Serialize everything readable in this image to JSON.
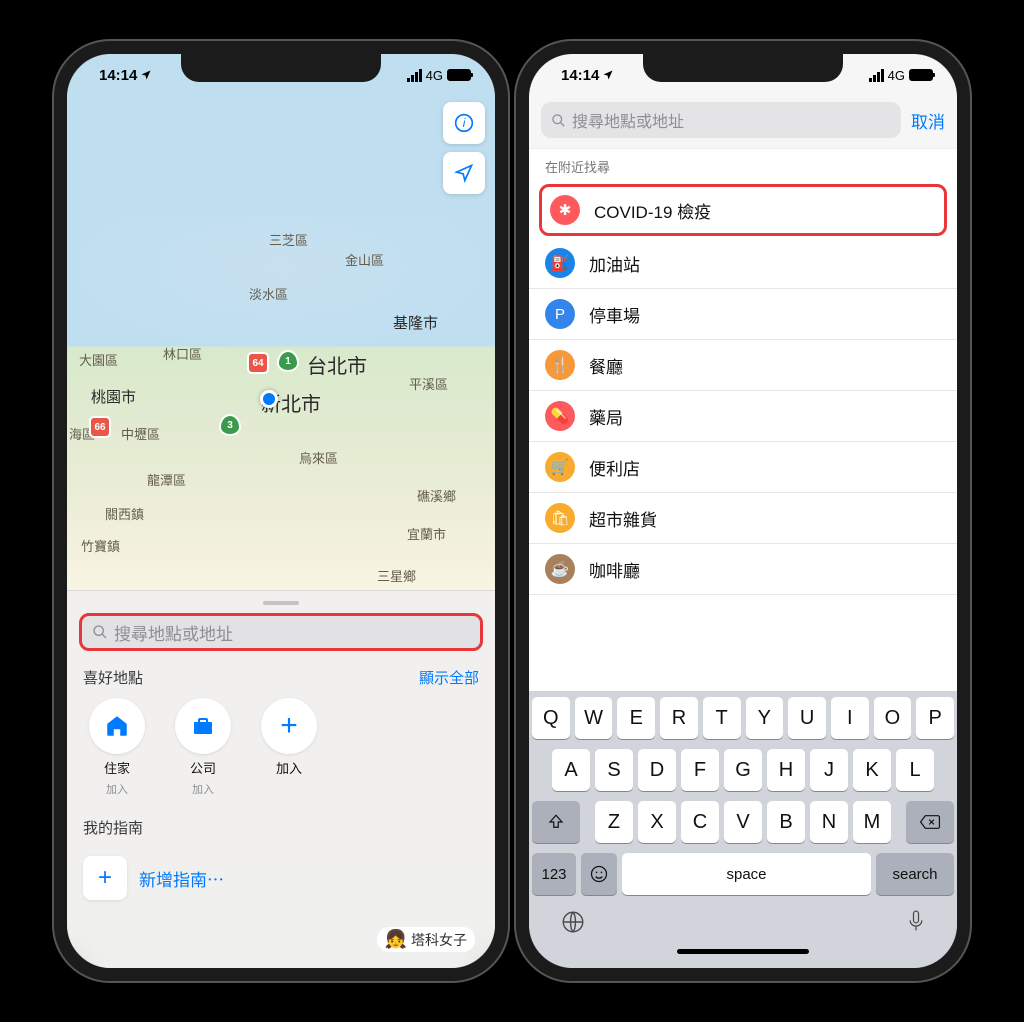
{
  "status": {
    "time": "14:14",
    "network": "4G"
  },
  "phone1": {
    "search_placeholder": "搜尋地點或地址",
    "map_labels": {
      "taipei": "台北市",
      "newtaipei": "新北市",
      "taoyuan": "桃園市",
      "zhongli": "中壢區",
      "jinshan": "金山區",
      "jilong": "基隆市",
      "tamsui": "淡水區",
      "sanzhi": "三芝區",
      "linkou": "林口區",
      "dayuan": "大園區",
      "haiqu": "海區",
      "longtan": "龍潭區",
      "guanxi": "關西鎮",
      "zhubao": "竹寶鎮",
      "pingxi": "平溪區",
      "wulai": "烏來區",
      "jiaoxi": "礁溪鄉",
      "sanxing": "三星鄉",
      "yilan": "宜蘭市",
      "badge64": "64",
      "badge1": "1",
      "badge3": "3",
      "badge66": "66"
    },
    "favorites": {
      "section_title": "喜好地點",
      "show_all": "顯示全部",
      "items": [
        {
          "name": "住家",
          "sub": "加入",
          "icon": "home"
        },
        {
          "name": "公司",
          "sub": "加入",
          "icon": "briefcase"
        },
        {
          "name": "加入",
          "sub": "",
          "icon": "plus"
        }
      ]
    },
    "guides": {
      "section_title": "我的指南",
      "add_label": "新增指南⋯"
    }
  },
  "phone2": {
    "search_placeholder": "搜尋地點或地址",
    "cancel": "取消",
    "nearby_label": "在附近找尋",
    "categories": [
      {
        "label": "COVID-19 檢疫",
        "icon_name": "medical-icon",
        "color": "#fe5a5e",
        "glyph": "✱",
        "highlighted": true
      },
      {
        "label": "加油站",
        "icon_name": "gas-icon",
        "color": "#1b84e8",
        "glyph": "⛽"
      },
      {
        "label": "停車場",
        "icon_name": "parking-icon",
        "color": "#3485eb",
        "glyph": "P"
      },
      {
        "label": "餐廳",
        "icon_name": "restaurant-icon",
        "color": "#f79939",
        "glyph": "🍴"
      },
      {
        "label": "藥局",
        "icon_name": "pharmacy-icon",
        "color": "#fe5a5e",
        "glyph": "💊"
      },
      {
        "label": "便利店",
        "icon_name": "convenience-icon",
        "color": "#f7ac30",
        "glyph": "🛒"
      },
      {
        "label": "超市雜貨",
        "icon_name": "grocery-icon",
        "color": "#f7ac30",
        "glyph": "🛍"
      },
      {
        "label": "咖啡廳",
        "icon_name": "cafe-icon",
        "color": "#a8815c",
        "glyph": "☕"
      }
    ],
    "keyboard": {
      "row1": [
        "Q",
        "W",
        "E",
        "R",
        "T",
        "Y",
        "U",
        "I",
        "O",
        "P"
      ],
      "row2": [
        "A",
        "S",
        "D",
        "F",
        "G",
        "H",
        "J",
        "K",
        "L"
      ],
      "row3": [
        "Z",
        "X",
        "C",
        "V",
        "B",
        "N",
        "M"
      ],
      "numkey": "123",
      "space": "space",
      "search": "search"
    }
  },
  "watermark": "塔科女子"
}
